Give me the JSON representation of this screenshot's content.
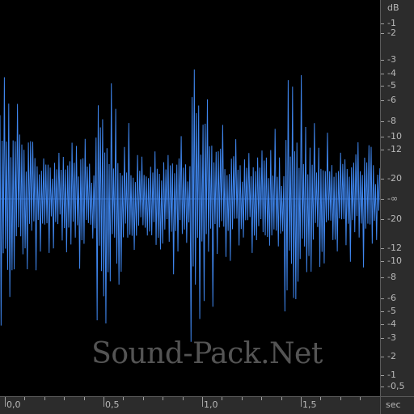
{
  "colors": {
    "waveform": "#3f86ee",
    "background": "#000000",
    "ruler": "#2c2c2c",
    "ruler_text": "#b8b8b8"
  },
  "db_ruler": {
    "unit": "dB",
    "labels": [
      "-1",
      "-2",
      "-3",
      "-4",
      "-5",
      "-6",
      "-8",
      "-10",
      "-12",
      "-20",
      "-∞",
      "-20",
      "-12",
      "-10",
      "-8",
      "-6",
      "-5",
      "-4",
      "-3",
      "-2",
      "-1",
      "-0,5"
    ]
  },
  "time_ruler": {
    "unit": "sec",
    "labels": [
      "0,0",
      "0,5",
      "1,0",
      "1,5"
    ],
    "label_values": [
      0.0,
      0.5,
      1.0,
      1.5
    ]
  },
  "watermark": "Sound-Pack.Net"
}
